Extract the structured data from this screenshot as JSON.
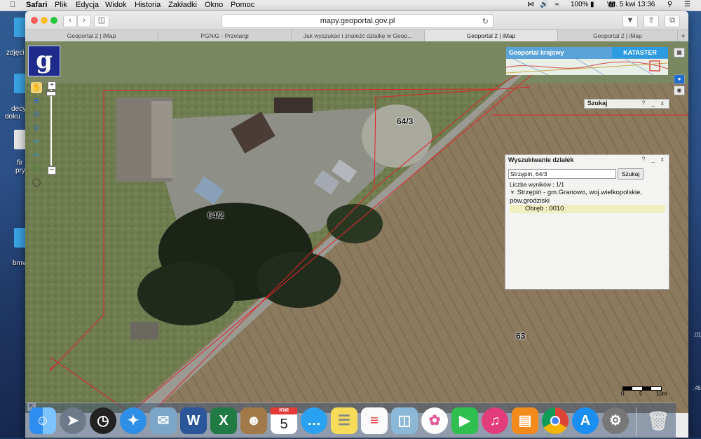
{
  "menubar": {
    "app": "Safari",
    "items": [
      "Plik",
      "Edycja",
      "Widok",
      "Historia",
      "Zakładki",
      "Okno",
      "Pomoc"
    ],
    "battery": "100%",
    "clock": "Wt. 5 kwi  13:36"
  },
  "desktop": {
    "labels": [
      "zdjęci",
      "decy",
      "doku",
      "fir",
      "pry",
      "bmv"
    ],
    "right_texts": [
      ".01",
      ".45"
    ]
  },
  "browser": {
    "url": "mapy.geoportal.gov.pl",
    "tabs": [
      {
        "label": "Geoportal 2 | iMap",
        "active": false
      },
      {
        "label": "PGNiG - Przetargi",
        "active": false
      },
      {
        "label": "Jak wyszukać i znaleźć działkę w Geop...",
        "active": false
      },
      {
        "label": "Geoportal 2 | iMap",
        "active": true
      },
      {
        "label": "Geoportal 2 | iMap",
        "active": false
      }
    ],
    "new_tab": "+"
  },
  "map": {
    "logo_letter": "g",
    "parcel_labels": [
      "64/3",
      "64/2",
      "63"
    ],
    "geoportal_label": "Geoportal krajowy",
    "kataster_label": "KATASTER",
    "scale_labels": [
      "0",
      "5",
      "10m"
    ],
    "zoom_plus": "+",
    "zoom_minus": "−"
  },
  "search_bar_panel": {
    "title": "Szukaj",
    "controls": "? _ x"
  },
  "parcel_search": {
    "title": "Wyszukiwanie działek",
    "controls": "? _ x",
    "query": "Strzępiń, 64/3",
    "button": "Szukaj",
    "result_count": "Liczba wyników : 1/1",
    "result_main": "Strzępiń - gm.Granowo, woj.wielkopolskie, pow.grodziski",
    "result_sub": "Obręb : 0010"
  },
  "dock": {
    "calendar_day": "5",
    "calendar_month": "KWI",
    "apps": [
      "finder-icon",
      "launchpad-icon",
      "dashboard-icon",
      "safari-icon",
      "mail-icon",
      "word-icon",
      "excel-icon",
      "contacts-icon",
      "calendar-icon",
      "messages-icon",
      "notes-icon",
      "reminders-icon",
      "preview-icon",
      "photos-icon",
      "facetime-icon",
      "itunes-icon",
      "ibooks-icon",
      "chrome-icon",
      "appstore-icon",
      "system-preferences-icon",
      "trash-icon"
    ]
  },
  "colors": {
    "parcel_line": "#e0242a",
    "kataster": "#2c9be0",
    "logo_bg": "#1f2b8a",
    "result_highlight": "#efefbf"
  }
}
